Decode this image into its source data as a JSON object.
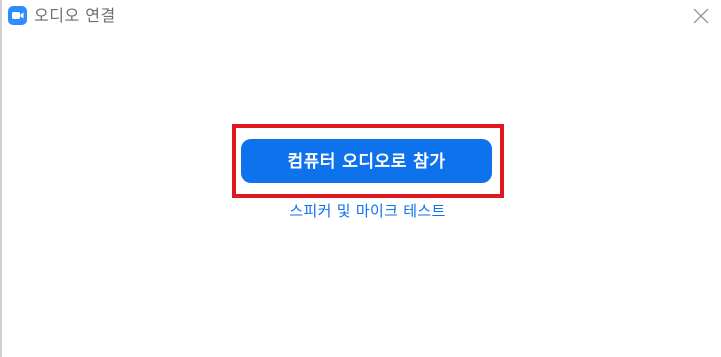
{
  "window": {
    "title": "오디오 연결",
    "app_icon": "zoom-camera-icon",
    "close_icon": "close-icon"
  },
  "main": {
    "join_audio_button": "컴퓨터 오디오로 참가",
    "test_link": "스피커 및 마이크 테스트"
  },
  "colors": {
    "accent": "#0e72ed",
    "highlight": "#e2161e",
    "title_text": "#6e6e73"
  }
}
